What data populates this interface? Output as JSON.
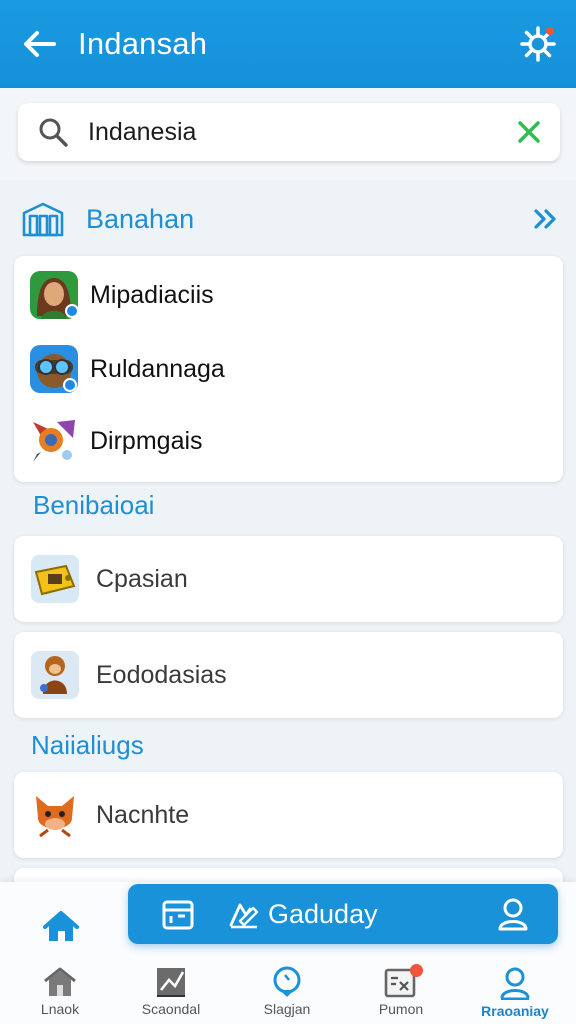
{
  "appbar": {
    "title": "Indansah"
  },
  "search": {
    "value": "Indanesia"
  },
  "section": {
    "title": "Banahan",
    "items": [
      {
        "label": "Mipadiaciis",
        "icon": "woman-avatar-icon"
      },
      {
        "label": "Ruldannaga",
        "icon": "goggles-character-icon"
      },
      {
        "label": "Dirpmgais",
        "icon": "rocket-game-icon"
      }
    ]
  },
  "group2": {
    "title": "Benibaioai",
    "items": [
      {
        "label": "Cpasian",
        "icon": "yellow-box-game-icon"
      },
      {
        "label": "Eododasias",
        "icon": "monkey-character-icon"
      }
    ]
  },
  "group3": {
    "title": "Naiialiugs",
    "items": [
      {
        "label": "Nacnhte",
        "icon": "orange-cat-icon"
      }
    ]
  },
  "action_bar": {
    "label": "Gaduday"
  },
  "bottom_nav": [
    {
      "label": "Lnaok",
      "icon": "house-icon"
    },
    {
      "label": "Scaondal",
      "icon": "chart-icon"
    },
    {
      "label": "Slagjan",
      "icon": "location-pin-icon"
    },
    {
      "label": "Pumon",
      "icon": "board-icon"
    },
    {
      "label": "Rraoaniay",
      "icon": "profile-icon"
    }
  ],
  "colors": {
    "primary": "#1a92d9",
    "accent_green": "#2fbd4f",
    "badge_red": "#f0543a"
  }
}
